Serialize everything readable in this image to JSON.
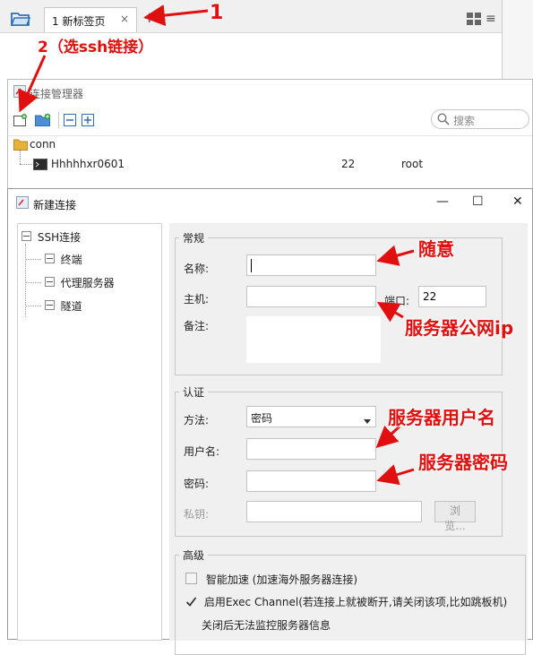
{
  "tabbar": {
    "tab_label": "1 新标签页",
    "close_glyph": "×",
    "new_tab_glyph": "+",
    "menu_glyph": "≡"
  },
  "connection_manager": {
    "title": "连接管理器",
    "search_placeholder": "搜索",
    "folder_name": "conn",
    "item": {
      "name": "Hhhhhxr0601",
      "port": "22",
      "user": "root"
    }
  },
  "dialog": {
    "title": "新建连接",
    "min_glyph": "—",
    "max_glyph": "☐",
    "close_glyph": "✕",
    "tree": [
      {
        "label": "SSH连接",
        "level": 0
      },
      {
        "label": "终端",
        "level": 1
      },
      {
        "label": "代理服务器",
        "level": 1
      },
      {
        "label": "隧道",
        "level": 1
      }
    ],
    "general": {
      "legend": "常规",
      "name_label": "名称:",
      "name_value": "",
      "host_label": "主机:",
      "host_value": "",
      "port_label": "端口:",
      "port_value": "22",
      "note_label": "备注:",
      "note_value": ""
    },
    "auth": {
      "legend": "认证",
      "method_label": "方法:",
      "method_value": "密码",
      "user_label": "用户名:",
      "user_value": "",
      "password_label": "密码:",
      "password_value": "",
      "key_label": "私钥:",
      "key_value": "",
      "browse_label": "浏览..."
    },
    "advanced": {
      "legend": "高级",
      "smart_accel_label": "智能加速 (加速海外服务器连接)",
      "smart_accel_checked": false,
      "exec_channel_label": "启用Exec Channel(若连接上就被断开,请关闭该项,比如跳板机)",
      "exec_channel_checked": true,
      "exec_channel_note": "关闭后无法监控服务器信息"
    }
  },
  "annotations": {
    "step1": "1",
    "step2": "2（选ssh链接）",
    "name_note": "随意",
    "host_note": "服务器公网ip",
    "user_note": "服务器用户名",
    "password_note": "服务器密码"
  },
  "colors": {
    "annotation": "#e01010",
    "folder": "#e8b23a",
    "icon_blue": "#2f6fb8",
    "icon_green": "#38a33a"
  }
}
